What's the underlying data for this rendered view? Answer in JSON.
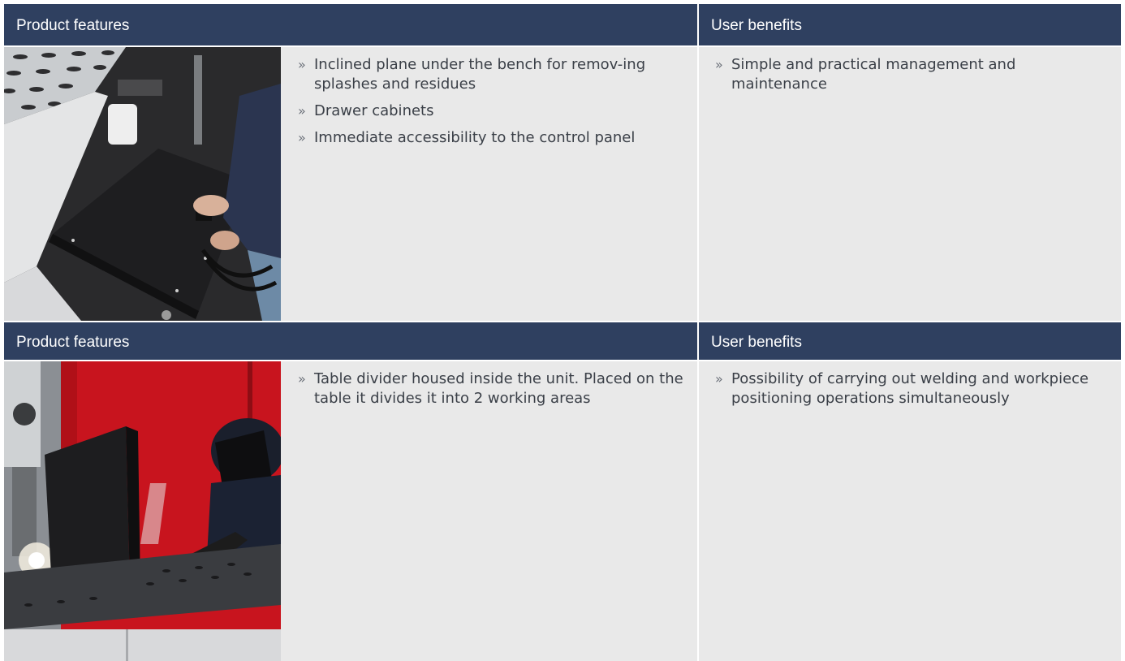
{
  "sections": [
    {
      "features_header": "Product features",
      "benefits_header": "User benefits",
      "bullet": "»",
      "features": [
        "Inclined plane under the bench for remov-ing splashes and residues",
        "Drawer cabinets",
        "Immediate accessibility to the control panel"
      ],
      "benefits": [
        "Simple and practical management and maintenance"
      ]
    },
    {
      "features_header": "Product features",
      "benefits_header": "User benefits",
      "bullet": "»",
      "features": [
        "Table divider housed inside the unit. Placed on the table it divides it into 2 working areas"
      ],
      "benefits": [
        "Possibility of carrying out welding and workpiece positioning operations simultaneously"
      ]
    }
  ],
  "colors": {
    "header_bg": "#2f4060",
    "cell_bg": "#e9e9e9",
    "photo2_red": "#c8141e"
  }
}
